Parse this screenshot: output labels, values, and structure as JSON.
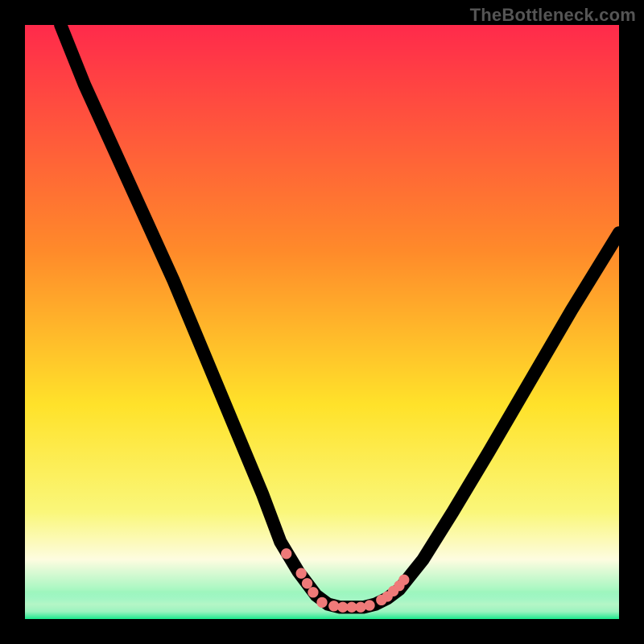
{
  "watermark": "TheBottleneck.com",
  "colors": {
    "top": "#ff2a4b",
    "mid_upper": "#ff8a2a",
    "mid": "#ffe22a",
    "lower_yellow": "#faf77a",
    "pale": "#fdfce0",
    "green_light": "#a9f7c2",
    "green": "#1ae88c",
    "frame": "#000000",
    "marker": "#ef7a79"
  },
  "chart_data": {
    "type": "line",
    "title": "",
    "xlabel": "",
    "ylabel": "",
    "xlim": [
      0,
      100
    ],
    "ylim": [
      0,
      100
    ],
    "grid": false,
    "legend": false,
    "series": [
      {
        "name": "bottleneck-curve",
        "x": [
          6,
          10,
          15,
          20,
          25,
          30,
          35,
          40,
          43,
          46,
          49,
          51,
          53,
          55,
          57,
          59,
          61,
          63,
          67,
          72,
          78,
          85,
          92,
          100
        ],
        "y": [
          100,
          90,
          79,
          68,
          57,
          45,
          33,
          21,
          13,
          8,
          4,
          2.5,
          2,
          2,
          2,
          2.5,
          3.5,
          5,
          10,
          18,
          28,
          40,
          52,
          65
        ]
      }
    ],
    "minimum_band_x": [
      49,
      60
    ],
    "markers": [
      {
        "x": 44,
        "y": 11
      },
      {
        "x": 46.5,
        "y": 7.7
      },
      {
        "x": 47.5,
        "y": 6.0
      },
      {
        "x": 48.5,
        "y": 4.5
      },
      {
        "x": 50,
        "y": 2.8
      },
      {
        "x": 52,
        "y": 2.2
      },
      {
        "x": 53.5,
        "y": 2
      },
      {
        "x": 55,
        "y": 2
      },
      {
        "x": 56.5,
        "y": 2
      },
      {
        "x": 58,
        "y": 2.3
      },
      {
        "x": 60,
        "y": 3.2
      },
      {
        "x": 61,
        "y": 3.8
      },
      {
        "x": 62,
        "y": 4.7
      },
      {
        "x": 63,
        "y": 5.6
      },
      {
        "x": 63.8,
        "y": 6.6
      }
    ],
    "marker_radius": 0.9
  }
}
